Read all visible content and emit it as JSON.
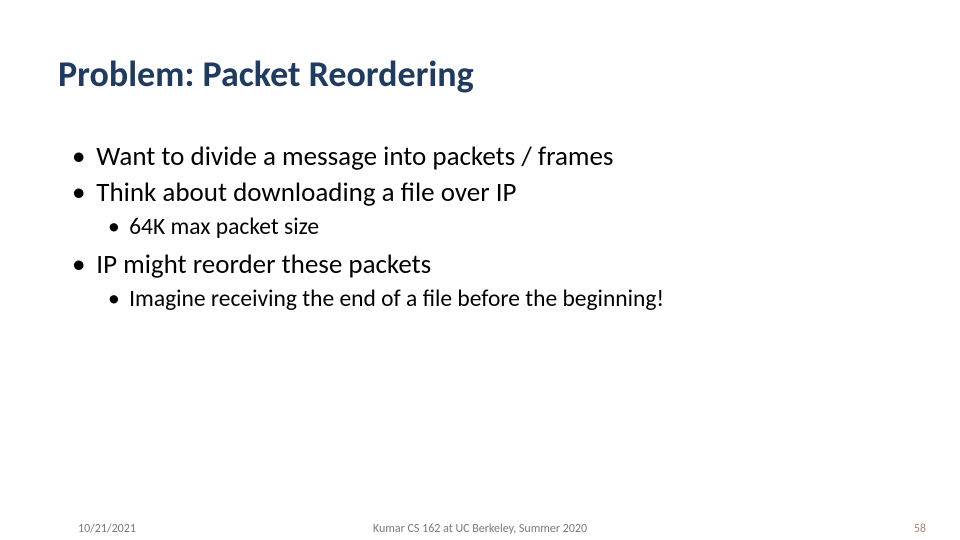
{
  "title": "Problem: Packet Reordering",
  "bullets": {
    "b1": "Want to divide a message into packets / frames",
    "b2": "Think about downloading a file over IP",
    "b2a": "64K max packet size",
    "b3": "IP might reorder these packets",
    "b3a": "Imagine receiving the end of a file before the beginning!"
  },
  "footer": {
    "date": "10/21/2021",
    "center": "Kumar CS 162 at UC Berkeley, Summer 2020",
    "page": "58"
  }
}
